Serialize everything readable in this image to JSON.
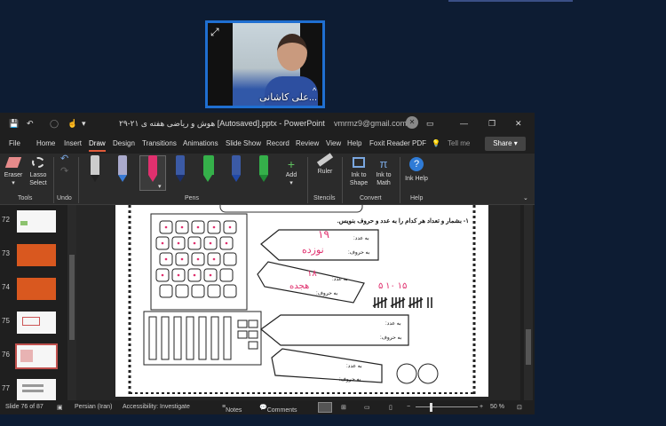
{
  "video": {
    "name": "علی کاشانی..."
  },
  "titlebar": {
    "document": "هوش و ریاضی هفته ی ۲۱-۲۹ [Autosaved].pptx - PowerPoint",
    "account": "vmrmz9@gmail.com"
  },
  "menu": {
    "tabs": [
      "File",
      "Home",
      "Insert",
      "Draw",
      "Design",
      "Transitions",
      "Animations",
      "Slide Show",
      "Record",
      "Review",
      "View",
      "Help",
      "Foxit Reader PDF"
    ],
    "tell_me": "Tell me",
    "share": "Share"
  },
  "ribbon": {
    "eraser": "Eraser",
    "lasso": "Lasso Select",
    "tools": "Tools",
    "undo": "Undo",
    "pens": "Pens",
    "add": "Add",
    "ruler": "Ruler",
    "stencils": "Stencils",
    "ink_to_shape": "Ink to Shape",
    "ink_to_math": "Ink to Math",
    "convert": "Convert",
    "ink_help": "Ink Help",
    "help": "Help"
  },
  "thumbs": [
    "72",
    "73",
    "74",
    "75",
    "76",
    "77"
  ],
  "slide": {
    "heading": "۱- بشمار و تعداد هر کدام را به عدد و حروف بنویس.",
    "label_number": "به عدد:",
    "label_words": "به حروف:",
    "ink_1a": "۱۹",
    "ink_1b": "نوزده",
    "ink_2a": "۱۸",
    "ink_2b": "هجده",
    "ink_3": "۵ ۱۰ ۱۵"
  },
  "status": {
    "slide": "Slide 76 of 87",
    "language": "Persian (Iran)",
    "accessibility": "Accessibility: Investigate",
    "notes": "Notes",
    "comments": "Comments",
    "zoom": "50 %"
  },
  "colors": {
    "bg": "#0d1c33",
    "accent": "#e05a3a",
    "ink": "#e0306e"
  }
}
